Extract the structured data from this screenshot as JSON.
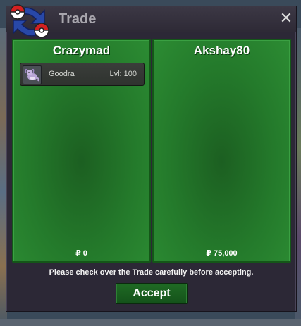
{
  "window": {
    "title": "Trade",
    "close_glyph": "✕"
  },
  "panels": [
    {
      "player": "Crazymad",
      "items": [
        {
          "icon": "goodra-sprite-icon",
          "name": "Goodra",
          "level": "Lvl: 100"
        }
      ],
      "money": "₽ 0"
    },
    {
      "player": "Akshay80",
      "items": [],
      "money": "₽ 75,000"
    }
  ],
  "footer": {
    "notice": "Please check over the Trade carefully before accepting.",
    "accept_label": "Accept"
  },
  "colors": {
    "panel_green": "#247a2b",
    "window_bg": "#2c2836",
    "accept_green": "#1f6a24"
  }
}
